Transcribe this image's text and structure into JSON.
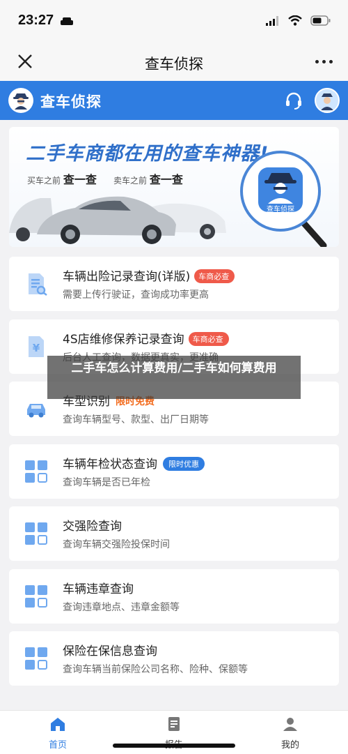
{
  "status": {
    "time": "23:27"
  },
  "nav": {
    "title": "查车侦探"
  },
  "app_header": {
    "name": "查车侦探",
    "logo_caption": "查车侦探"
  },
  "banner": {
    "title": "二手车商都在用的查车神器!",
    "sub1_prefix": "买车之前",
    "sub1_action": "查一查",
    "sub2_prefix": "卖车之前",
    "sub2_action": "查一查",
    "logo_caption": "查车侦探"
  },
  "items": [
    {
      "title": "车辆出险记录查询(详版)",
      "subtitle": "需要上传行驶证，查询成功率更高",
      "badge": "车商必查",
      "icon": "document-search-icon"
    },
    {
      "title": "4S店维修保养记录查询",
      "subtitle": "后台人工查询，数据更真实，更准确",
      "badge": "车商必查",
      "icon": "yuan-document-icon"
    },
    {
      "title": "车型识别",
      "subtitle": "查询车辆型号、款型、出厂日期等",
      "badge": "限时免费",
      "icon": "car-icon"
    },
    {
      "title": "车辆年检状态查询",
      "subtitle": "查询车辆是否已年检",
      "badge": "限时优惠",
      "icon": "grid-icon"
    },
    {
      "title": "交强险查询",
      "subtitle": "查询车辆交强险投保时间",
      "icon": "grid-icon"
    },
    {
      "title": "车辆违章查询",
      "subtitle": "查询违章地点、违章金额等",
      "icon": "grid-icon"
    },
    {
      "title": "保险在保信息查询",
      "subtitle": "查询车辆当前保险公司名称、险种、保额等",
      "icon": "grid-icon"
    }
  ],
  "overlay": {
    "text": "二手车怎么计算费用/二手车如何算费用"
  },
  "tabs": [
    {
      "label": "首页",
      "icon": "home-icon",
      "active": true
    },
    {
      "label": "报告",
      "icon": "report-icon",
      "active": false
    },
    {
      "label": "我的",
      "icon": "user-icon",
      "active": false
    }
  ],
  "colors": {
    "primary": "#2f7de1",
    "badge_red": "#ef5a4a",
    "badge_orange": "#f26b1d",
    "icon_blue": "#6fa8ef"
  }
}
